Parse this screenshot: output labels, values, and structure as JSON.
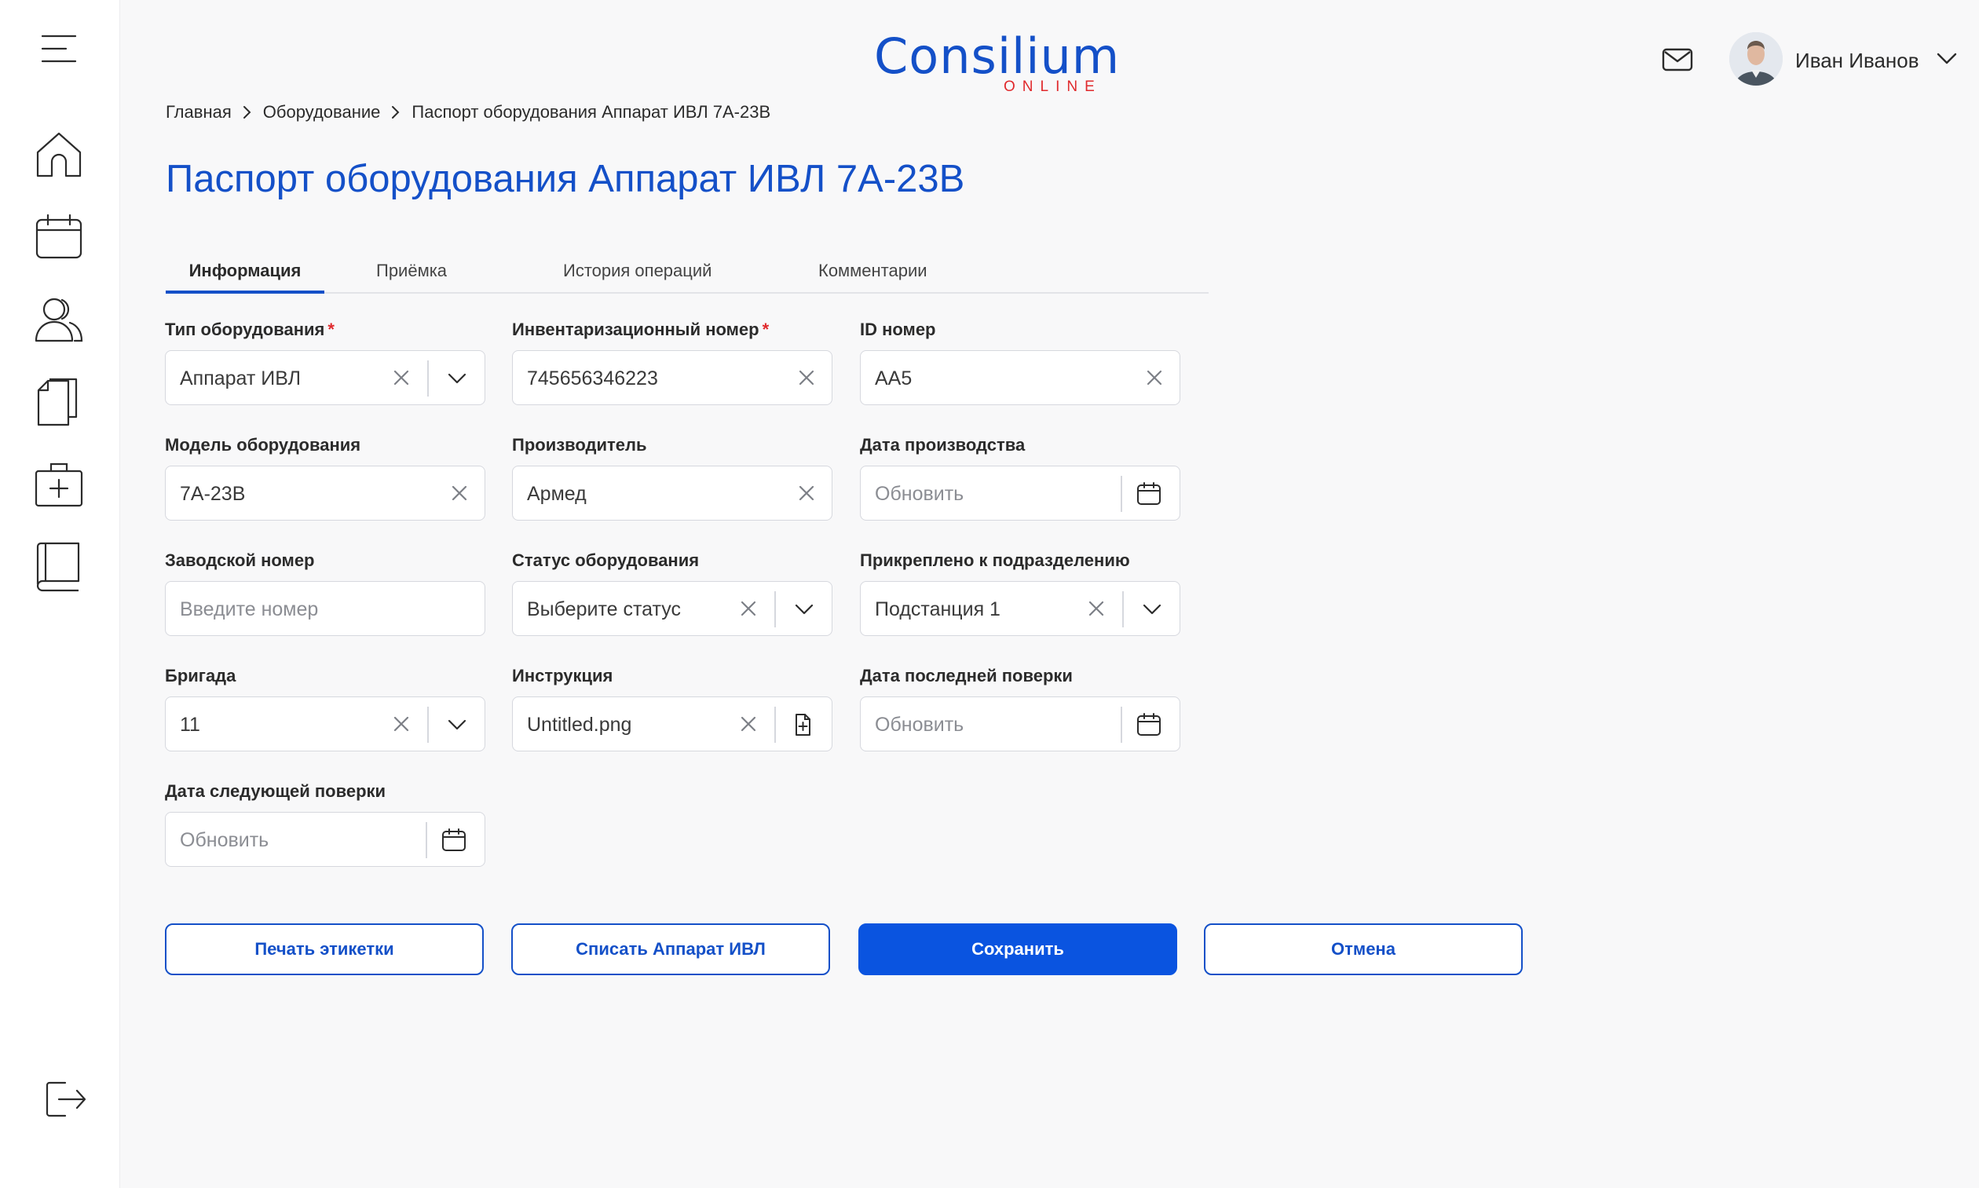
{
  "header": {
    "logo_main": "Consilium",
    "logo_sub": "ONLINE",
    "user_name": "Иван Иванов"
  },
  "sidebar": {
    "items": [
      {
        "icon": "menu-icon"
      },
      {
        "icon": "home-icon"
      },
      {
        "icon": "calendar-icon"
      },
      {
        "icon": "users-icon"
      },
      {
        "icon": "documents-icon"
      },
      {
        "icon": "medical-kit-icon"
      },
      {
        "icon": "book-icon"
      },
      {
        "icon": "logout-icon"
      }
    ]
  },
  "breadcrumb": [
    "Главная",
    "Оборудование",
    "Паспорт оборудования Аппарат ИВЛ 7А-23В"
  ],
  "page_title": "Паспорт оборудования Аппарат ИВЛ 7А-23В",
  "tabs": [
    "Информация",
    "Приёмка",
    "История операций",
    "Комментарии"
  ],
  "active_tab": "Информация",
  "form": {
    "equipment_type": {
      "label": "Тип оборудования",
      "required": "*",
      "value": "Аппарат ИВЛ"
    },
    "inventory_number": {
      "label": "Инвентаризационный номер",
      "required": "*",
      "value": "745656346223"
    },
    "id_number": {
      "label": "ID номер",
      "value": "AA5"
    },
    "model": {
      "label": "Модель оборудования",
      "value": "7А-23В"
    },
    "manufacturer": {
      "label": "Производитель",
      "value": "Армед"
    },
    "production_date": {
      "label": "Дата производства",
      "placeholder": "Обновить"
    },
    "serial_number": {
      "label": "Заводской номер",
      "placeholder": "Введите номер"
    },
    "status": {
      "label": "Статус оборудования",
      "placeholder": "Выберите статус"
    },
    "department": {
      "label": "Прикреплено к подразделению",
      "value": "Подстанция 1"
    },
    "brigade": {
      "label": "Бригада",
      "value": "11"
    },
    "instruction": {
      "label": "Инструкция",
      "value": "Untitled.png"
    },
    "last_check_date": {
      "label": "Дата последней поверки",
      "placeholder": "Обновить"
    },
    "next_check_date": {
      "label": "Дата следующей поверки",
      "placeholder": "Обновить"
    }
  },
  "actions": {
    "print_label": "Печать этикетки",
    "write_off": "Списать Аппарат ИВЛ",
    "save": "Сохранить",
    "cancel": "Отмена"
  },
  "colors": {
    "accent": "#1450c8",
    "primary_button": "#0a54e0",
    "required": "#e0292c"
  }
}
